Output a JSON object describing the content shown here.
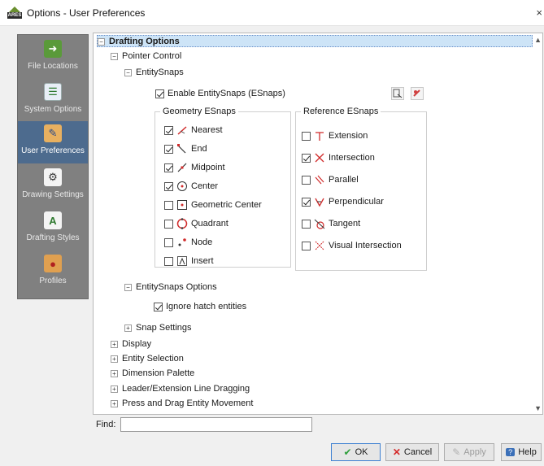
{
  "window": {
    "title": "Options - User Preferences",
    "app_icon_text": "ARES"
  },
  "sidebar": {
    "items": [
      {
        "label": "File Locations",
        "icon": "folder-arrow-icon",
        "active": false
      },
      {
        "label": "System Options",
        "icon": "checklist-icon",
        "active": false
      },
      {
        "label": "User Preferences",
        "icon": "user-ruler-icon",
        "active": true
      },
      {
        "label": "Drawing Settings",
        "icon": "compass-icon",
        "active": false
      },
      {
        "label": "Drafting Styles",
        "icon": "text-style-icon",
        "active": false
      },
      {
        "label": "Profiles",
        "icon": "user-profile-icon",
        "active": false
      }
    ]
  },
  "tree": {
    "drafting_options": "Drafting Options",
    "pointer_control": "Pointer Control",
    "entity_snaps": "EntitySnaps",
    "enable_esnaps": {
      "label": "Enable EntitySnaps (ESnaps)",
      "checked": true
    },
    "geometry": {
      "title": "Geometry ESnaps",
      "items": [
        {
          "label": "Nearest",
          "checked": true,
          "icon": "nearest-snap-icon"
        },
        {
          "label": "End",
          "checked": true,
          "icon": "end-snap-icon"
        },
        {
          "label": "Midpoint",
          "checked": true,
          "icon": "midpoint-snap-icon"
        },
        {
          "label": "Center",
          "checked": true,
          "icon": "center-snap-icon"
        },
        {
          "label": "Geometric Center",
          "checked": false,
          "icon": "geometric-center-snap-icon"
        },
        {
          "label": "Quadrant",
          "checked": false,
          "icon": "quadrant-snap-icon"
        },
        {
          "label": "Node",
          "checked": false,
          "icon": "node-snap-icon"
        },
        {
          "label": "Insert",
          "checked": false,
          "icon": "insert-snap-icon"
        }
      ]
    },
    "reference": {
      "title": "Reference ESnaps",
      "items": [
        {
          "label": "Extension",
          "checked": false,
          "icon": "extension-snap-icon"
        },
        {
          "label": "Intersection",
          "checked": true,
          "icon": "intersection-snap-icon"
        },
        {
          "label": "Parallel",
          "checked": false,
          "icon": "parallel-snap-icon"
        },
        {
          "label": "Perpendicular",
          "checked": true,
          "icon": "perpendicular-snap-icon"
        },
        {
          "label": "Tangent",
          "checked": false,
          "icon": "tangent-snap-icon"
        },
        {
          "label": "Visual Intersection",
          "checked": false,
          "icon": "visual-intersection-snap-icon"
        }
      ]
    },
    "esnaps_options": "EntitySnaps Options",
    "ignore_hatch": {
      "label": "Ignore hatch entities",
      "checked": true
    },
    "snap_settings": "Snap Settings",
    "sections": [
      "Display",
      "Entity Selection",
      "Dimension Palette",
      "Leader/Extension Line Dragging",
      "Press and Drag Entity Movement"
    ]
  },
  "find": {
    "label": "Find:",
    "value": ""
  },
  "buttons": {
    "ok": "OK",
    "cancel": "Cancel",
    "apply": "Apply",
    "help": "Help"
  },
  "colors": {
    "sidebar_bg": "#808080",
    "sidebar_active": "#4d6b8e",
    "selection": "#cde4f7",
    "ok_check": "#2e9e3b",
    "cancel_x": "#d42a2a"
  }
}
